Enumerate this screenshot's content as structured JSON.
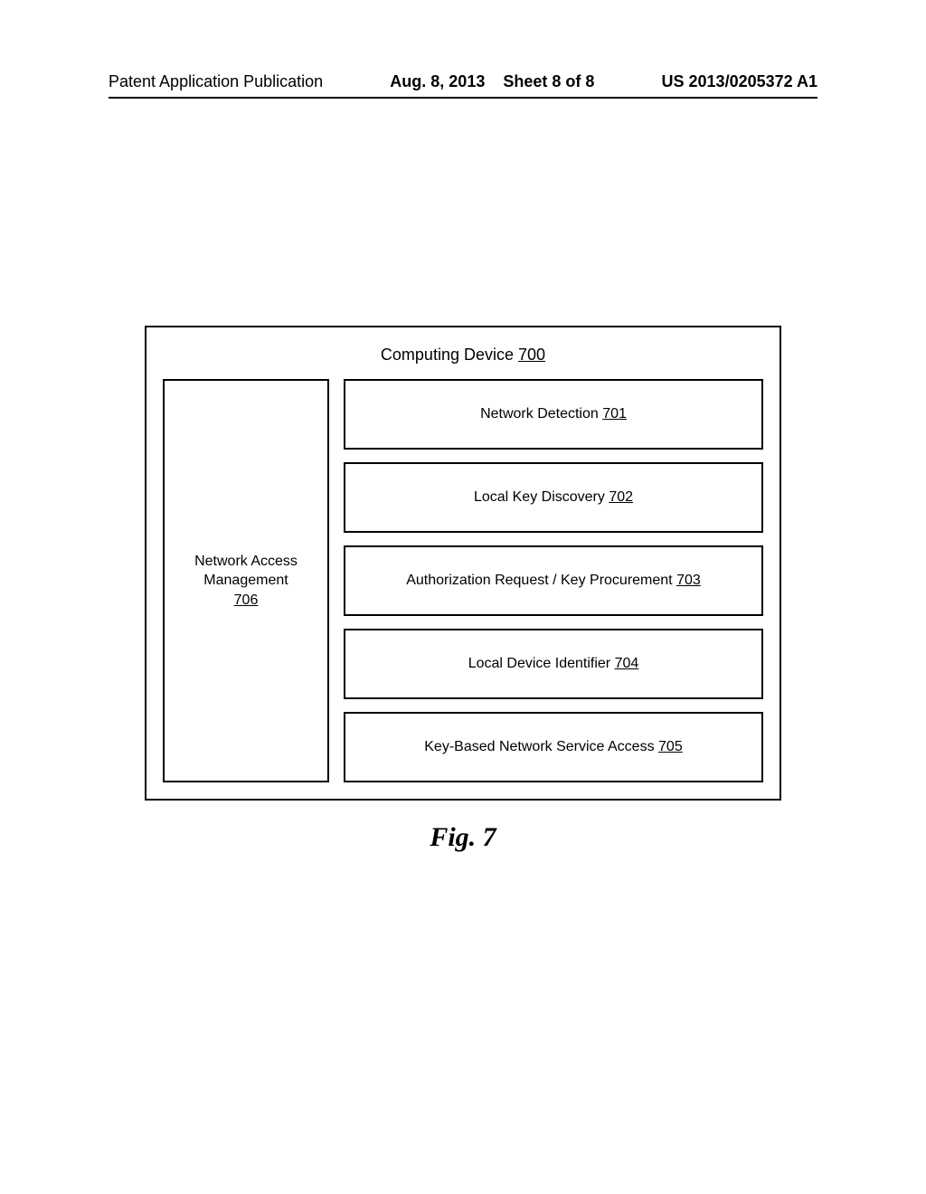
{
  "header": {
    "left": "Patent Application Publication",
    "center_date": "Aug. 8, 2013",
    "center_sheet": "Sheet 8 of 8",
    "right": "US 2013/0205372 A1"
  },
  "figure": {
    "outer": {
      "label": "Computing Device",
      "num": "700"
    },
    "left_box": {
      "line1": "Network Access",
      "line2": "Management",
      "num": "706"
    },
    "modules": [
      {
        "label": "Network Detection",
        "num": "701"
      },
      {
        "label": "Local Key Discovery",
        "num": "702"
      },
      {
        "label": "Authorization Request / Key Procurement",
        "num": "703"
      },
      {
        "label": "Local Device Identifier",
        "num": "704"
      },
      {
        "label": "Key-Based Network Service Access",
        "num": "705"
      }
    ],
    "caption": "Fig. 7"
  }
}
